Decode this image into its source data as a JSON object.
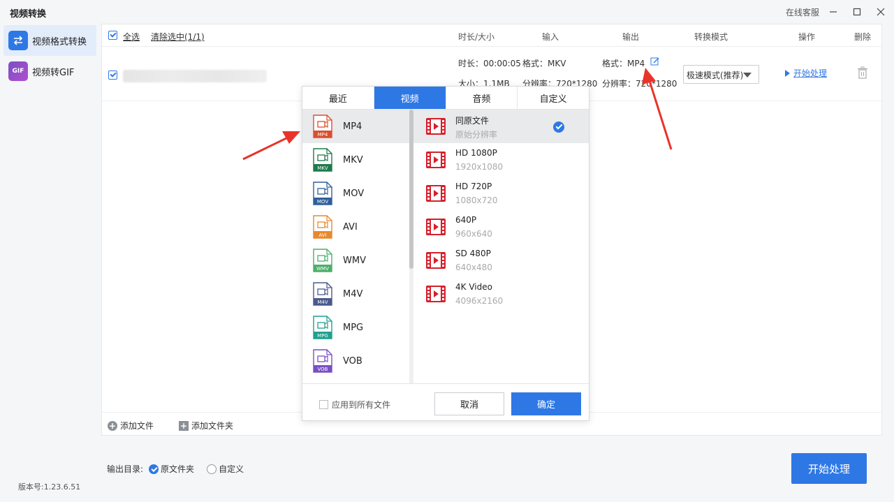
{
  "window": {
    "title": "视频转换",
    "online_service": "在线客服"
  },
  "sidebar": {
    "items": [
      {
        "label": "视频格式转换",
        "active": true,
        "icon": "swap-icon"
      },
      {
        "label": "视频转GIF",
        "active": false,
        "icon": "gif-icon",
        "icon_text": "GIF"
      }
    ],
    "version": "版本号:1.23.6.51"
  },
  "list_header": {
    "select_all": "全选",
    "clear_selected": "清除选中(1/1)",
    "columns": [
      "时长/大小",
      "输入",
      "输出",
      "转换模式",
      "操作",
      "删除"
    ]
  },
  "file_row": {
    "duration": "时长：00:00:05",
    "size": "大小：1.1MB",
    "input_format": "格式：MKV",
    "input_resolution": "分辨率：720*1280",
    "output_format": "格式：MP4",
    "output_resolution": "分辨率：720*1280",
    "mode": "极速模式(推荐)",
    "start": "开始处理"
  },
  "footer": {
    "add_file": "添加文件",
    "add_folder": "添加文件夹",
    "output_dir_label": "输出目录:",
    "opt_original": "原文件夹",
    "opt_custom": "自定义",
    "start_button": "开始处理"
  },
  "popup": {
    "tabs": [
      {
        "label": "最近",
        "active": false
      },
      {
        "label": "视频",
        "active": true
      },
      {
        "label": "音频",
        "active": false
      },
      {
        "label": "自定义",
        "active": false
      }
    ],
    "formats": [
      {
        "label": "MP4",
        "tag": "MP4",
        "color": "#d9502f",
        "selected": true
      },
      {
        "label": "MKV",
        "tag": "MKV",
        "color": "#1f7a4b"
      },
      {
        "label": "MOV",
        "tag": "MOV",
        "color": "#2f5f9c"
      },
      {
        "label": "AVI",
        "tag": "AVI",
        "color": "#e8892c"
      },
      {
        "label": "WMV",
        "tag": "WMV",
        "color": "#4caf6a"
      },
      {
        "label": "M4V",
        "tag": "M4V",
        "color": "#4a5a8c"
      },
      {
        "label": "MPG",
        "tag": "MPG",
        "color": "#1fa08e"
      },
      {
        "label": "VOB",
        "tag": "VOB",
        "color": "#7a4fc4"
      }
    ],
    "resolutions": [
      {
        "name": "同原文件",
        "sub": "原始分辨率",
        "selected": true
      },
      {
        "name": "HD 1080P",
        "sub": "1920x1080"
      },
      {
        "name": "HD 720P",
        "sub": "1080x720"
      },
      {
        "name": "640P",
        "sub": "960x640"
      },
      {
        "name": "SD 480P",
        "sub": "640x480"
      },
      {
        "name": "4K Video",
        "sub": "4096x2160"
      }
    ],
    "apply_all": "应用到所有文件",
    "cancel": "取消",
    "ok": "确定"
  },
  "colors": {
    "accent": "#2e78e6",
    "annotation_arrow": "#e8342a"
  }
}
